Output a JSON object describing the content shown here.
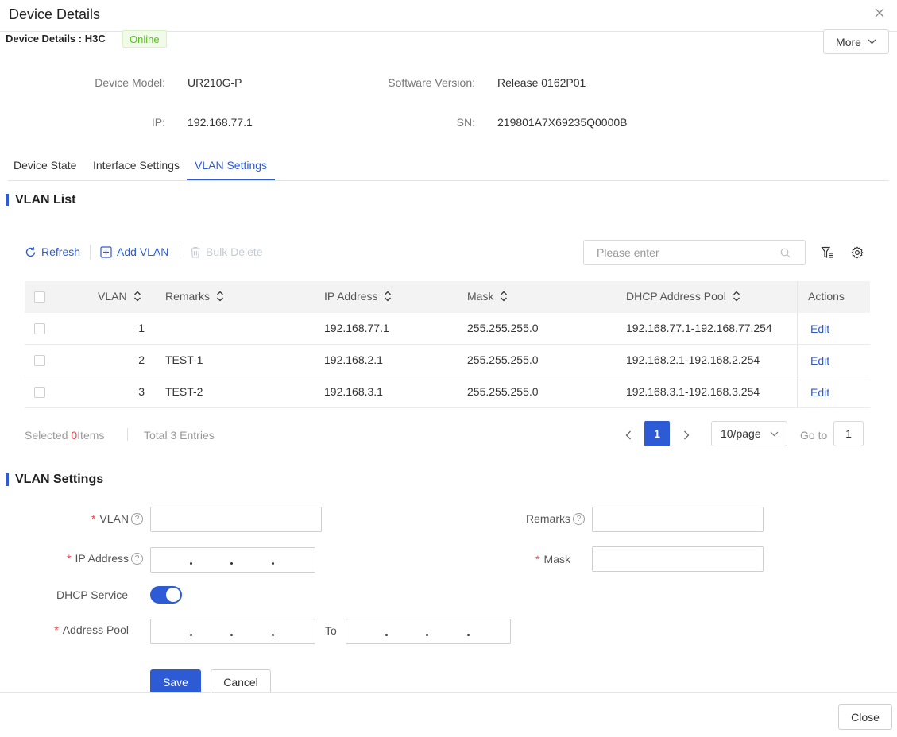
{
  "dialog": {
    "title": "Device Details",
    "close_button": "Close"
  },
  "device": {
    "heading": "Device Details : H3C",
    "status": "Online",
    "more_label": "More",
    "model_label": "Device Model:",
    "model_value": "UR210G-P",
    "software_label": "Software Version:",
    "software_value": "Release 0162P01",
    "ip_label": "IP:",
    "ip_value": "192.168.77.1",
    "sn_label": "SN:",
    "sn_value": "219801A7X69235Q0000B"
  },
  "tabs": [
    {
      "label": "Device State",
      "active": false
    },
    {
      "label": "Interface Settings",
      "active": false
    },
    {
      "label": "VLAN Settings",
      "active": true
    }
  ],
  "vlan_list": {
    "title": "VLAN List",
    "toolbar": {
      "refresh": "Refresh",
      "add": "Add VLAN",
      "bulk_delete": "Bulk Delete",
      "search_placeholder": "Please enter"
    },
    "columns": [
      "VLAN",
      "Remarks",
      "IP Address",
      "Mask",
      "DHCP Address Pool",
      "Actions"
    ],
    "rows": [
      {
        "vlan": "1",
        "remarks": "",
        "ip": "192.168.77.1",
        "mask": "255.255.255.0",
        "pool": "192.168.77.1-192.168.77.254",
        "action": "Edit"
      },
      {
        "vlan": "2",
        "remarks": "TEST-1",
        "ip": "192.168.2.1",
        "mask": "255.255.255.0",
        "pool": "192.168.2.1-192.168.2.254",
        "action": "Edit"
      },
      {
        "vlan": "3",
        "remarks": "TEST-2",
        "ip": "192.168.3.1",
        "mask": "255.255.255.0",
        "pool": "192.168.3.1-192.168.3.254",
        "action": "Edit"
      }
    ],
    "footer": {
      "selected_prefix": "Selected",
      "selected_count": "0",
      "selected_suffix": "Items",
      "total_prefix": "Total",
      "total_count": "3",
      "total_suffix": "Entries",
      "current_page": "1",
      "page_size": "10/page",
      "goto_label": "Go to",
      "goto_value": "1"
    }
  },
  "vlan_settings": {
    "title": "VLAN Settings",
    "vlan_label": "VLAN",
    "remarks_label": "Remarks",
    "ip_label": "IP Address",
    "mask_label": "Mask",
    "dhcp_label": "DHCP Service",
    "dhcp_enabled": true,
    "pool_label": "Address Pool",
    "to_label": "To",
    "save": "Save",
    "cancel": "Cancel"
  },
  "colors": {
    "accent": "#2d5bd6",
    "online": "#52c41a",
    "required": "#e8424d"
  }
}
